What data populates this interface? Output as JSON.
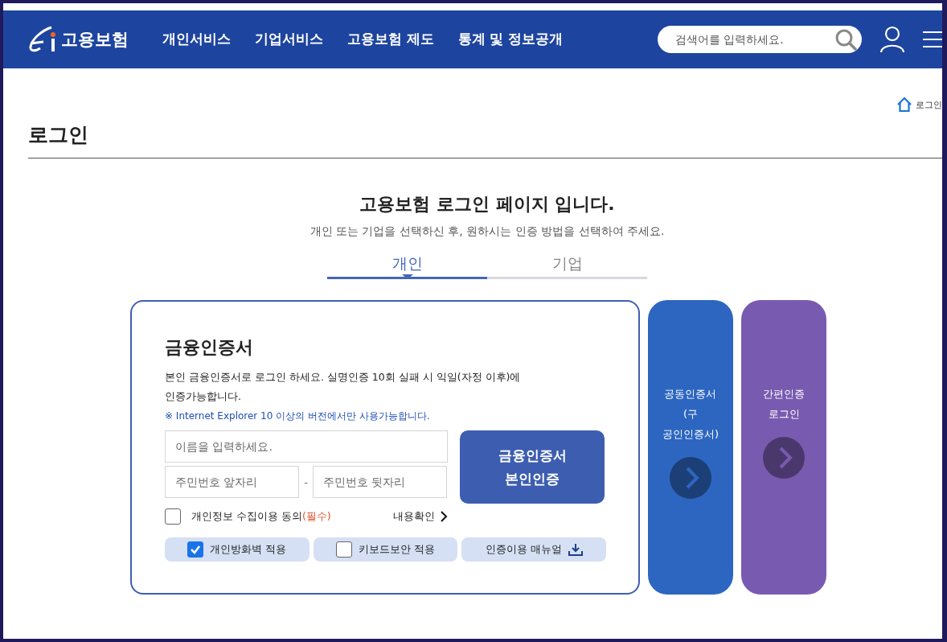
{
  "header": {
    "logo": "고용보험",
    "nav": [
      {
        "label": "개인서비스"
      },
      {
        "label": "기업서비스"
      },
      {
        "label": "고용보험 제도"
      },
      {
        "label": "통계 및 정보공개"
      }
    ],
    "search": {
      "placeholder": "검색어를 입력하세요."
    }
  },
  "breadcrumb": "로그인",
  "page_title": "로그인",
  "intro": {
    "heading": "고용보험 로그인 페이지 입니다.",
    "subtitle": "개인 또는 기업을 선택하신 후, 원하시는 인증 방법을 선택하여 주세요."
  },
  "tabs": [
    {
      "label": "개인",
      "selected": true
    },
    {
      "label": "기업",
      "selected": false
    }
  ],
  "certificate": {
    "title": "금융인증서",
    "description": "본인 금융인증서로 로그인 하세요. 실명인증 10회 실패 시 익일(자정 이후)에 인증가능합니다.",
    "notice": "※ Internet Explorer 10 이상의 버전에서만 사용가능합니다.",
    "name_field": {
      "placeholder": "이름을 입력하세요."
    },
    "id_front": {
      "placeholder": "주민번호 앞자리"
    },
    "separator": "-",
    "id_back": {
      "placeholder": "주민번호 뒷자리"
    },
    "submit": [
      "금융인증서",
      "본인인증"
    ],
    "consent": {
      "label": "개인정보 수집이용 동의",
      "required": "(필수)",
      "checked": false,
      "link": "내용확인"
    },
    "options": [
      {
        "kind": "checkbox",
        "label": "개인방화벽 적용",
        "checked": true
      },
      {
        "kind": "checkbox",
        "label": "키보드보안 적용",
        "checked": false
      },
      {
        "kind": "download",
        "label": "인증이용 매뉴얼"
      }
    ]
  },
  "side_cards": [
    {
      "lines": [
        "공동인증서",
        "(구",
        "공인인증서)"
      ],
      "color": "#2d66c0"
    },
    {
      "lines": [
        "간편인증",
        "로그인"
      ],
      "color": "#785bb0"
    }
  ]
}
